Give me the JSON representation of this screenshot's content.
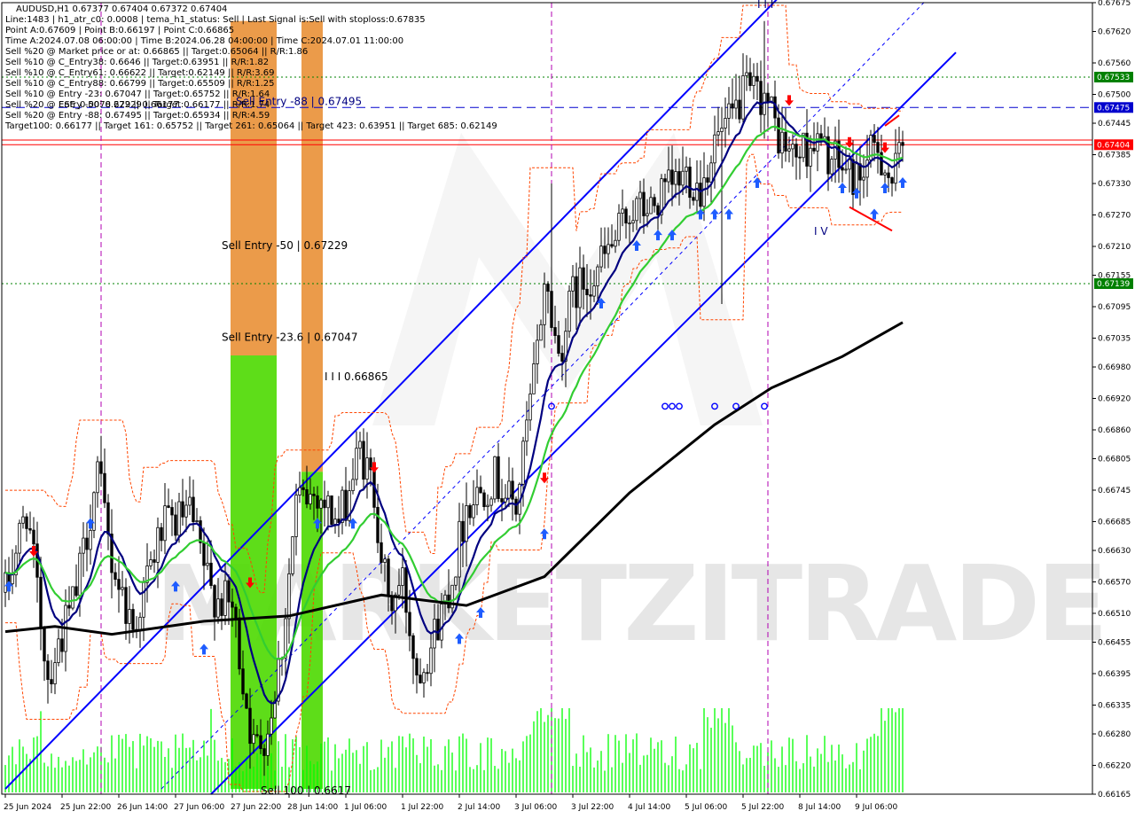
{
  "colors": {
    "background": "#ffffff",
    "grid": "#c0c0c0",
    "candle": "#000000",
    "volume": "#00ff00",
    "channel": "#0000ff",
    "ma_navy": "#000080",
    "ma_green": "#32cd32",
    "ma_black": "#000000",
    "fractal_orange": "#ff4500",
    "level_red": "#ff0000",
    "level_green": "#008000",
    "level_blue": "#0000cd",
    "vline_magenta": "#b000b0",
    "zone_orange": "#e88a2a",
    "zone_green": "#4cd900",
    "arrow_up": "#1e5cff",
    "arrow_down": "#ff0000",
    "watermark": "#e6e6e6"
  },
  "header": {
    "symbol_line": "AUDUSD,H1  0.67377 0.67404 0.67372 0.67404",
    "lines": [
      "Line:1483 | h1_atr_c0: 0.0008 | tema_h1_status: Sell | Last Signal is:Sell with stoploss:0.67835",
      "Point A:0.67609 | Point B:0.66197 | Point C:0.66865",
      "Time A:2024.07.08 06:00:00 | Time B:2024.06.28 04:00:00 | Time C:2024.07.01 11:00:00",
      "Sell %20 @ Market price or at: 0.66865 || Target:0.65064 || R/R:1.86",
      "Sell %10 @ C_Entry38: 0.6646 || Target:0.63951 || R/R:1.82",
      "Sell %10 @ C_Entry61: 0.66622 || Target:0.62149 || R/R:3.69",
      "Sell %10 @ C_Entry88: 0.66799 || Target:0.65509 || R/R:1.25",
      "Sell %10 @ Entry -23: 0.67047 || Target:0.65752 || R/R:1.64",
      "Sell %20 @ Entry -50: 0.67229 || Target:0.66177 || R/R:1.74",
      "Sell %20 @ Entry -88: 0.67495 || Target:0.65934 || R/R:4.59",
      "Target100: 0.66177 || Target 161: 0.65752 || Target 261: 0.65064 || Target 423: 0.63951 || Target 685: 0.62149"
    ],
    "overlap_text": "ESE_0.0078 229 || 0.66177"
  },
  "watermark": "MARKETZITRADE",
  "chart_data": {
    "type": "candlestick",
    "symbol": "AUDUSD",
    "timeframe": "H1",
    "ylim": [
      0.66165,
      0.67675
    ],
    "y_ticks": [
      "0.67675",
      "0.67620",
      "0.67560",
      "0.67500",
      "0.67445",
      "0.67385",
      "0.67330",
      "0.67270",
      "0.67210",
      "0.67155",
      "0.67095",
      "0.67035",
      "0.66980",
      "0.66920",
      "0.66860",
      "0.66805",
      "0.66745",
      "0.66685",
      "0.66630",
      "0.66570",
      "0.66510",
      "0.66455",
      "0.66395",
      "0.66335",
      "0.66280",
      "0.66220",
      "0.66165"
    ],
    "x_ticks": [
      "25 Jun 2024",
      "25 Jun 22:00",
      "26 Jun 14:00",
      "27 Jun 06:00",
      "27 Jun 22:00",
      "28 Jun 14:00",
      "1 Jul 06:00",
      "1 Jul 22:00",
      "2 Jul 14:00",
      "3 Jul 06:00",
      "3 Jul 22:00",
      "4 Jul 14:00",
      "5 Jul 06:00",
      "5 Jul 22:00",
      "8 Jul 14:00",
      "9 Jul 06:00"
    ],
    "x_tick_bars": [
      0,
      16,
      32,
      48,
      64,
      80,
      96,
      112,
      128,
      144,
      160,
      176,
      192,
      208,
      224,
      240
    ],
    "bar_count": 254,
    "close_anchors": [
      [
        0,
        0.6655
      ],
      [
        6,
        0.6671
      ],
      [
        12,
        0.6639
      ],
      [
        20,
        0.6655
      ],
      [
        26,
        0.6678
      ],
      [
        30,
        0.6661
      ],
      [
        36,
        0.6648
      ],
      [
        44,
        0.6667
      ],
      [
        52,
        0.667
      ],
      [
        58,
        0.6655
      ],
      [
        64,
        0.6652
      ],
      [
        70,
        0.6625
      ],
      [
        74,
        0.6629
      ],
      [
        78,
        0.6645
      ],
      [
        82,
        0.6672
      ],
      [
        88,
        0.6674
      ],
      [
        94,
        0.6668
      ],
      [
        100,
        0.6682
      ],
      [
        104,
        0.6674
      ],
      [
        108,
        0.6652
      ],
      [
        112,
        0.6657
      ],
      [
        116,
        0.664
      ],
      [
        120,
        0.6645
      ],
      [
        126,
        0.6658
      ],
      [
        130,
        0.6672
      ],
      [
        138,
        0.6677
      ],
      [
        144,
        0.6671
      ],
      [
        150,
        0.6701
      ],
      [
        152,
        0.6715
      ],
      [
        156,
        0.67
      ],
      [
        160,
        0.6712
      ],
      [
        166,
        0.6716
      ],
      [
        172,
        0.6722
      ],
      [
        176,
        0.6728
      ],
      [
        182,
        0.6728
      ],
      [
        186,
        0.6731
      ],
      [
        192,
        0.6735
      ],
      [
        196,
        0.6732
      ],
      [
        200,
        0.6741
      ],
      [
        204,
        0.6744
      ],
      [
        208,
        0.675
      ],
      [
        214,
        0.675
      ],
      [
        218,
        0.6742
      ],
      [
        222,
        0.6738
      ],
      [
        228,
        0.6741
      ],
      [
        234,
        0.6737
      ],
      [
        240,
        0.6734
      ],
      [
        246,
        0.674
      ],
      [
        250,
        0.6733
      ],
      [
        253,
        0.674
      ]
    ],
    "series": [
      {
        "name": "",
        "kind": "ma",
        "color": "#000080",
        "period": 12
      },
      {
        "name": "",
        "kind": "ma",
        "color": "#32cd32",
        "period": 26
      },
      {
        "name": "",
        "kind": "ma_tail",
        "color": "#000000",
        "x": [
          0,
          14,
          30,
          56,
          80,
          106,
          130,
          152,
          176,
          200,
          216,
          236,
          253
        ],
        "y": [
          0.66475,
          0.66485,
          0.6647,
          0.66495,
          0.66505,
          0.66545,
          0.66525,
          0.6658,
          0.6674,
          0.6687,
          0.6694,
          0.67,
          0.67065
        ]
      }
    ],
    "volume": {
      "type": "bar",
      "max_relative": 1.0
    },
    "levels": [
      {
        "price": 0.67404,
        "color": "#ff0000",
        "style": "solid",
        "label": "0.67404"
      },
      {
        "price": 0.67413,
        "color": "#ff0000",
        "style": "solid",
        "label": ""
      },
      {
        "price": 0.67475,
        "color": "#0000cd",
        "style": "dashed",
        "label": "0.67475"
      },
      {
        "price": 0.67533,
        "color": "#008000",
        "style": "dotted",
        "label": "0.67533"
      },
      {
        "price": 0.67139,
        "color": "#008000",
        "style": "dotted",
        "label": "0.67139"
      }
    ],
    "channel_lines": [
      {
        "from": [
          0,
          0.66175
        ],
        "to": [
          226,
          0.6774
        ],
        "style": "solid"
      },
      {
        "from": [
          58,
          0.66165
        ],
        "to": [
          268,
          0.6758
        ],
        "style": "solid"
      },
      {
        "from": [
          44,
          0.66175
        ],
        "to": [
          274,
          0.6778
        ],
        "style": "dashed"
      }
    ],
    "vlines": [
      {
        "bar": 27
      },
      {
        "bar": 154
      },
      {
        "bar": 215
      }
    ],
    "zones": [
      {
        "from_bar": 64,
        "to_bar": 76,
        "price_top": 0.6764,
        "price_bottom": 0.67002,
        "color": "#e88a2a",
        "alpha": 0.85
      },
      {
        "from_bar": 64,
        "to_bar": 76,
        "price_top": 0.67002,
        "price_bottom": 0.66175,
        "color": "#4cd900",
        "alpha": 0.9
      },
      {
        "from_bar": 84,
        "to_bar": 89,
        "price_top": 0.6764,
        "price_bottom": 0.6678,
        "color": "#e88a2a",
        "alpha": 0.85
      },
      {
        "from_bar": 84,
        "to_bar": 89,
        "price_top": 0.6678,
        "price_bottom": 0.66175,
        "color": "#4cd900",
        "alpha": 0.9
      }
    ],
    "annotations": [
      {
        "text": "Sell Entry -88 | 0.67495",
        "bar": 65,
        "price": 0.6748,
        "color": "#000080"
      },
      {
        "text": "Sell Entry -50 | 0.67229",
        "bar": 61,
        "price": 0.67205,
        "color": "#000000"
      },
      {
        "text": "Sell Entry -23.6 | 0.67047",
        "bar": 61,
        "price": 0.6703,
        "color": "#000000"
      },
      {
        "text": "I I I 0.66865",
        "bar": 90,
        "price": 0.66955,
        "color": "#000000"
      },
      {
        "text": "I V",
        "bar": 228,
        "price": 0.67232,
        "color": "#000080"
      },
      {
        "text": "I I I",
        "bar": 212,
        "price": 0.67665,
        "color": "#000080"
      },
      {
        "text": "Sell 100 | 0.6617",
        "bar": 72,
        "price": 0.66165,
        "color": "#000000"
      }
    ],
    "arrows_up": [
      [
        1,
        0.6656
      ],
      [
        24,
        0.6668
      ],
      [
        56,
        0.6644
      ],
      [
        48,
        0.6656
      ],
      [
        88,
        0.6668
      ],
      [
        98,
        0.6668
      ],
      [
        128,
        0.6646
      ],
      [
        134,
        0.6651
      ],
      [
        152,
        0.6666
      ],
      [
        168,
        0.671
      ],
      [
        178,
        0.6721
      ],
      [
        184,
        0.6723
      ],
      [
        188,
        0.6723
      ],
      [
        196,
        0.6727
      ],
      [
        200,
        0.6727
      ],
      [
        204,
        0.6727
      ],
      [
        212,
        0.6733
      ],
      [
        236,
        0.6732
      ],
      [
        240,
        0.6731
      ],
      [
        248,
        0.6732
      ],
      [
        245,
        0.6727
      ],
      [
        253,
        0.6733
      ]
    ],
    "arrows_down": [
      [
        8,
        0.6663
      ],
      [
        69,
        0.6657
      ],
      [
        104,
        0.6679
      ],
      [
        152,
        0.6677
      ],
      [
        221,
        0.6749
      ],
      [
        238,
        0.6741
      ],
      [
        248,
        0.674
      ]
    ],
    "circle_markers": [
      [
        154,
        0.66905
      ],
      [
        186,
        0.66905
      ],
      [
        188,
        0.66905
      ],
      [
        190,
        0.66905
      ],
      [
        200,
        0.66905
      ],
      [
        206,
        0.66905
      ],
      [
        214,
        0.66905
      ]
    ],
    "red_wedge": [
      [
        238,
        0.67285
      ],
      [
        250,
        0.6724
      ],
      [
        248,
        0.6744
      ],
      [
        252,
        0.6746
      ]
    ]
  }
}
